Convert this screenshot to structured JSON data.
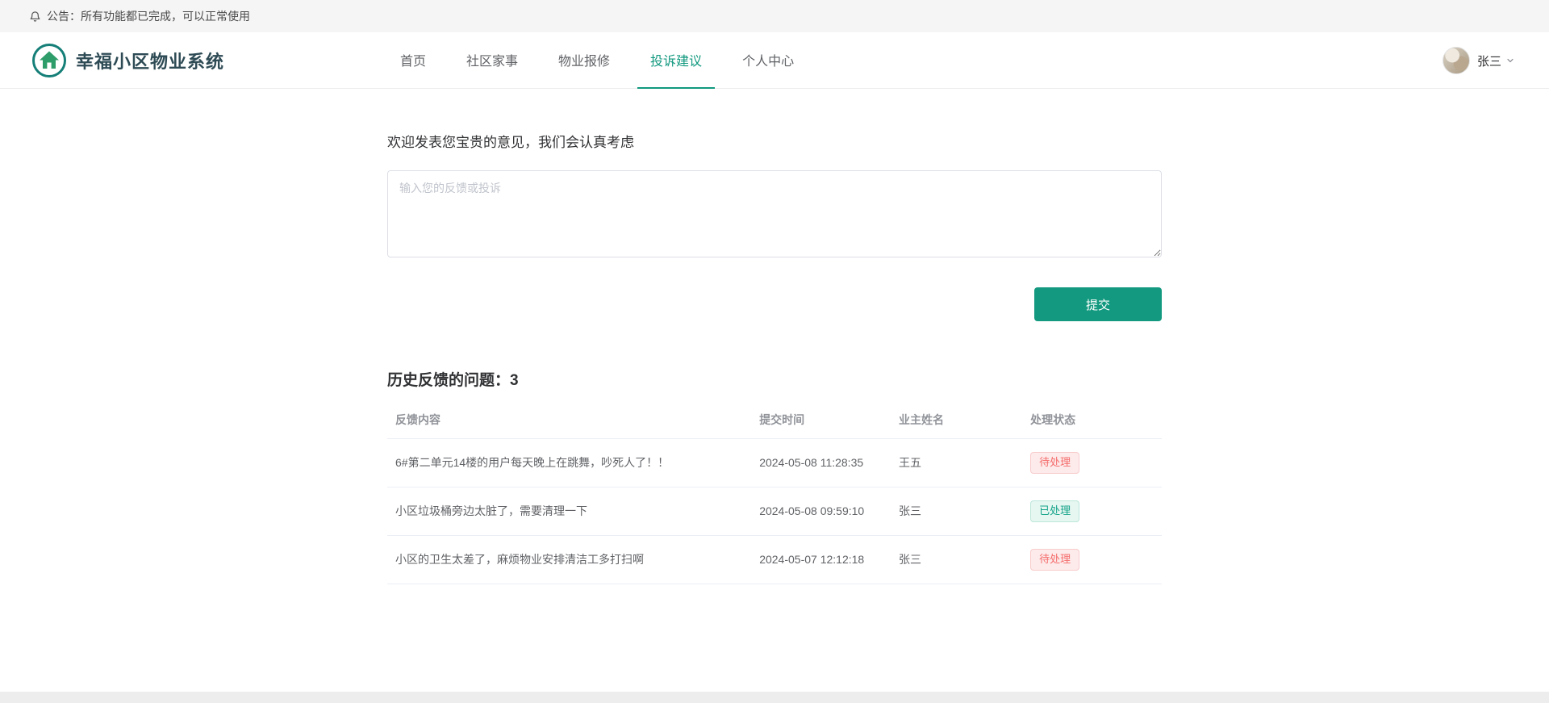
{
  "announcement": {
    "icon": "bell-icon",
    "text": "公告：所有功能都已完成，可以正常使用"
  },
  "header": {
    "title": "幸福小区物业系统",
    "logo_icon": "community-logo-icon",
    "nav": [
      {
        "key": "home",
        "label": "首页",
        "active": false
      },
      {
        "key": "community",
        "label": "社区家事",
        "active": false
      },
      {
        "key": "repair",
        "label": "物业报修",
        "active": false
      },
      {
        "key": "complaints",
        "label": "投诉建议",
        "active": true
      },
      {
        "key": "profile",
        "label": "个人中心",
        "active": false
      }
    ],
    "user": {
      "name": "张三",
      "dropdown_icon": "chevron-down-icon"
    }
  },
  "main": {
    "welcome": "欢迎发表您宝贵的意见，我们会认真考虑",
    "textarea_placeholder": "输入您的反馈或投诉",
    "textarea_value": "",
    "submit_label": "提交",
    "history_title": "历史反馈的问题：",
    "history_count": "3"
  },
  "table": {
    "headers": [
      "反馈内容",
      "提交时间",
      "业主姓名",
      "处理状态"
    ],
    "rows": [
      {
        "content": "6#第二单元14楼的用户每天晚上在跳舞，吵死人了！！",
        "time": "2024-05-08 11:28:35",
        "name": "王五",
        "status": "待处理",
        "status_type": "pending"
      },
      {
        "content": "小区垃圾桶旁边太脏了，需要清理一下",
        "time": "2024-05-08 09:59:10",
        "name": "张三",
        "status": "已处理",
        "status_type": "done"
      },
      {
        "content": "小区的卫生太差了，麻烦物业安排清洁工多打扫啊",
        "time": "2024-05-07 12:12:18",
        "name": "张三",
        "status": "待处理",
        "status_type": "pending"
      }
    ]
  },
  "colors": {
    "accent": "#12997f",
    "pending_text": "#f56c6c",
    "pending_bg": "#fdeaea",
    "done_text": "#14a489",
    "done_bg": "#e6f6f1"
  }
}
